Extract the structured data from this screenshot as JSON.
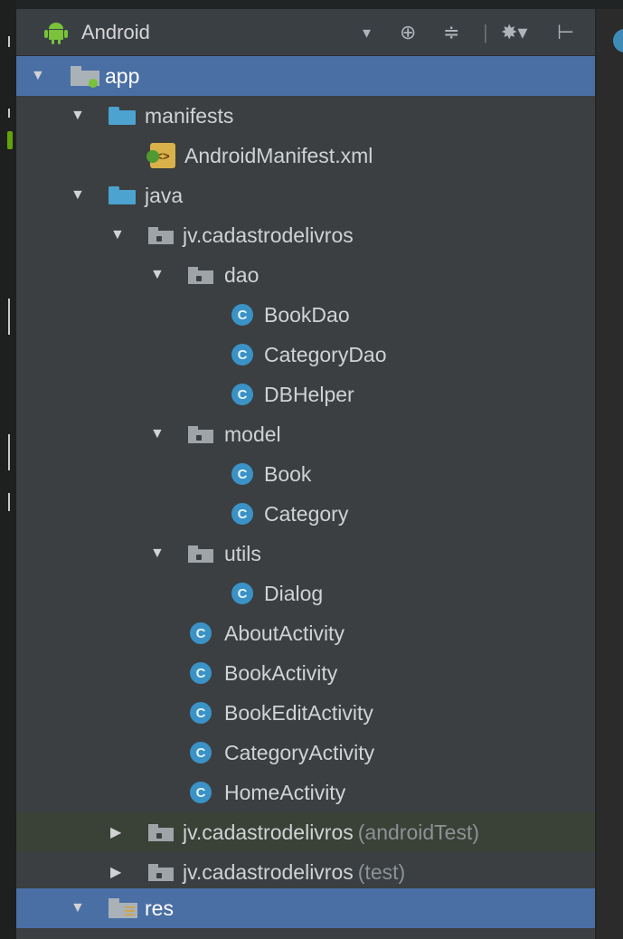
{
  "toolbar": {
    "view_title": "Android",
    "icons": [
      "android-icon",
      "dropdown-icon",
      "locate-icon",
      "collapse-icon",
      "settings-icon",
      "hide-icon"
    ],
    "dropdown_glyph": "▾",
    "locate_glyph": "⊕",
    "collapse_glyph": "≑",
    "separator_glyph": "|",
    "settings_glyph": "✸▾",
    "hide_glyph": "⊢"
  },
  "tree": {
    "expanded_arrow": "▼",
    "collapsed_arrow": "▶",
    "class_letter": "C",
    "manifest_glyph": "<>",
    "items": [
      {
        "label": "app",
        "kind": "module",
        "expanded": true,
        "selected": true
      },
      {
        "label": "manifests",
        "kind": "folder",
        "expanded": true
      },
      {
        "label": "AndroidManifest.xml",
        "kind": "manifest-file"
      },
      {
        "label": "java",
        "kind": "folder",
        "expanded": true
      },
      {
        "label": "jv.cadastrodelivros",
        "kind": "package",
        "expanded": true
      },
      {
        "label": "dao",
        "kind": "package",
        "expanded": true
      },
      {
        "label": "BookDao",
        "kind": "class"
      },
      {
        "label": "CategoryDao",
        "kind": "class"
      },
      {
        "label": "DBHelper",
        "kind": "class"
      },
      {
        "label": "model",
        "kind": "package",
        "expanded": true
      },
      {
        "label": "Book",
        "kind": "class"
      },
      {
        "label": "Category",
        "kind": "class"
      },
      {
        "label": "utils",
        "kind": "package",
        "expanded": true
      },
      {
        "label": "Dialog",
        "kind": "class"
      },
      {
        "label": "AboutActivity",
        "kind": "class"
      },
      {
        "label": "BookActivity",
        "kind": "class"
      },
      {
        "label": "BookEditActivity",
        "kind": "class"
      },
      {
        "label": "CategoryActivity",
        "kind": "class"
      },
      {
        "label": "HomeActivity",
        "kind": "class"
      },
      {
        "label": "jv.cadastrodelivros",
        "suffix": "(androidTest)",
        "kind": "package",
        "expanded": false
      },
      {
        "label": "jv.cadastrodelivros",
        "suffix": "(test)",
        "kind": "package",
        "expanded": false
      },
      {
        "label": "res",
        "kind": "res-folder",
        "expanded": true,
        "selected": true
      }
    ]
  },
  "colors": {
    "selection": "#4a6fa5",
    "class_icon": "#3a92c6",
    "folder_blue": "#4ca3cf",
    "panel_bg": "#3b3f41"
  }
}
